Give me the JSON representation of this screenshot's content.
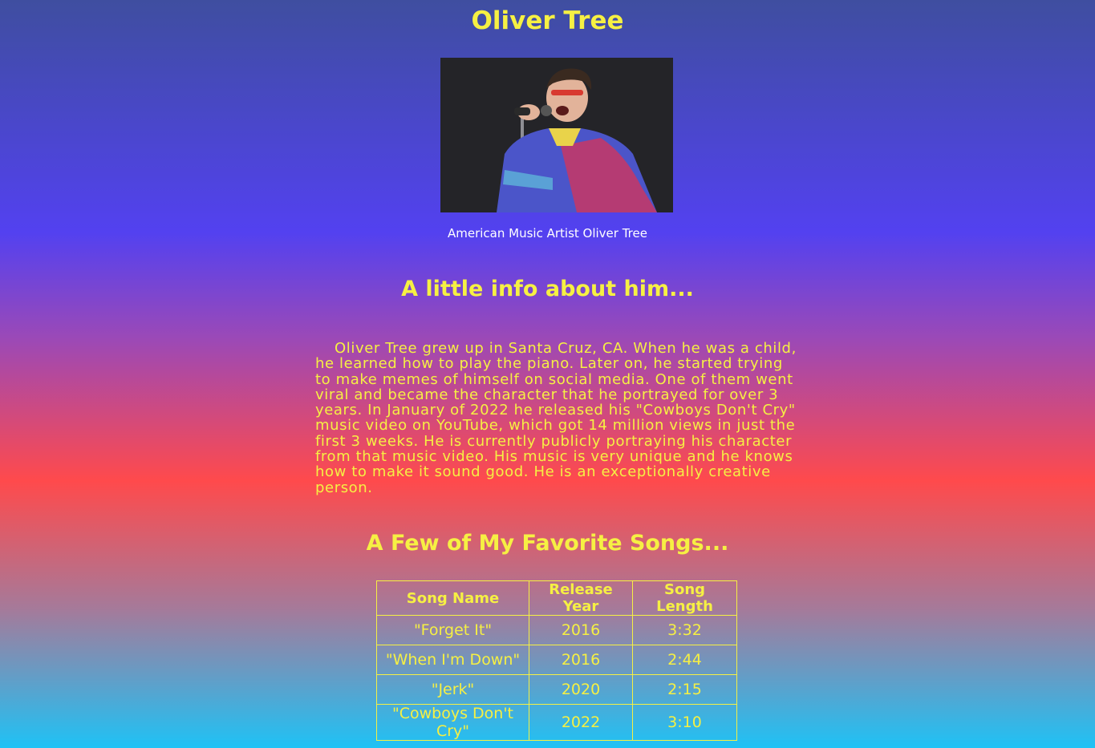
{
  "page": {
    "title": "Oliver Tree",
    "photo_caption": "American Music Artist Oliver Tree",
    "info_heading": "A little info about him...",
    "bio": "Oliver Tree grew up in Santa Cruz, CA. When he was a child, he learned how to play the piano. Later on, he started trying to make memes of himself on social media. One of them went viral and became the character that he portrayed for over 3 years. In January of 2022 he released his \"Cowboys Don't Cry\" music video on YouTube, which got 14 million views in just the first 3 weeks. He is currently publicly portraying his character from that music video. His music is very unique and he knows how to make it sound good. He is an exceptionally creative person.",
    "songs_heading": "A Few of My Favorite Songs..."
  },
  "table": {
    "headers": [
      "Song Name",
      "Release Year",
      "Song Length"
    ],
    "rows": [
      [
        "\"Forget It\"",
        "2016",
        "3:32"
      ],
      [
        "\"When I'm Down\"",
        "2016",
        "2:44"
      ],
      [
        "\"Jerk\"",
        "2020",
        "2:15"
      ],
      [
        "\"Cowboys Don't Cry\"",
        "2022",
        "3:10"
      ]
    ]
  },
  "colors": {
    "text_accent": "#f6f043",
    "caption": "#ffffff",
    "gradient": [
      "#3f4ea0",
      "#5341f0",
      "#ff4a4c",
      "#1fc2f5"
    ]
  }
}
